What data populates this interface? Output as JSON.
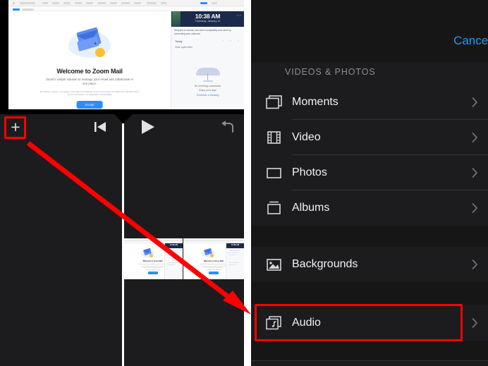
{
  "left_panel": {
    "name": "video-editor",
    "preview": {
      "app_title": "Welcome to Zoom Mail",
      "subtitle": "Zoom's simple solution to manage your email and collaborate in one place.",
      "legal": "By clicking \"Accept\", you agree to the Mail and Calendar Service description and Mail and Calendar Client service description, as applicable, located",
      "legal_link": "here",
      "accept_label": "Accept",
      "calendar": {
        "time": "10:38 AM",
        "date": "Thursday, January 11",
        "note": "Respond to events, see other's availability and more by connecting your calendar",
        "today_label": "Today",
        "host_label": "Host: Lydia Wen",
        "empty_title": "No meetings scheduled",
        "empty_sub": "Enjoy your day!",
        "schedule_link": "Schedule a Meeting",
        "menu_dots": "•••",
        "controls": "‹ □ ›"
      }
    },
    "toolbar": {
      "add_label": "+",
      "add_icon": "plus-icon",
      "skip_icon": "skip-to-start-icon",
      "play_icon": "play-icon",
      "undo_icon": "undo-icon"
    },
    "timeline": {
      "playhead_icon": "playhead-marker",
      "clips": [
        {
          "name": "clip-1",
          "title": "Welcome to Zoom Mail",
          "time": "10:38 AM"
        },
        {
          "name": "clip-2",
          "title": "Welcome to Zoom Mail",
          "time": "10:38 AM"
        }
      ]
    }
  },
  "right_panel": {
    "cancel_label": "Cancel",
    "sections": [
      {
        "header": "VIDEOS & PHOTOS",
        "items": [
          {
            "label": "Moments",
            "icon": "moments-icon",
            "chevron": "chevron-right-icon"
          },
          {
            "label": "Video",
            "icon": "film-strip-icon",
            "chevron": "chevron-right-icon"
          },
          {
            "label": "Photos",
            "icon": "photo-frame-icon",
            "chevron": "chevron-right-icon"
          },
          {
            "label": "Albums",
            "icon": "albums-icon",
            "chevron": "chevron-right-icon"
          }
        ]
      },
      {
        "header": "",
        "items": [
          {
            "label": "Backgrounds",
            "icon": "image-icon",
            "chevron": "chevron-right-icon"
          }
        ]
      },
      {
        "header": "",
        "items": [
          {
            "label": "Audio",
            "icon": "music-note-icon",
            "chevron": "chevron-right-icon"
          }
        ]
      }
    ]
  },
  "annotations": {
    "highlight_color": "#ff0000",
    "arrow_from": "add-button",
    "arrow_to": "audio-row"
  }
}
